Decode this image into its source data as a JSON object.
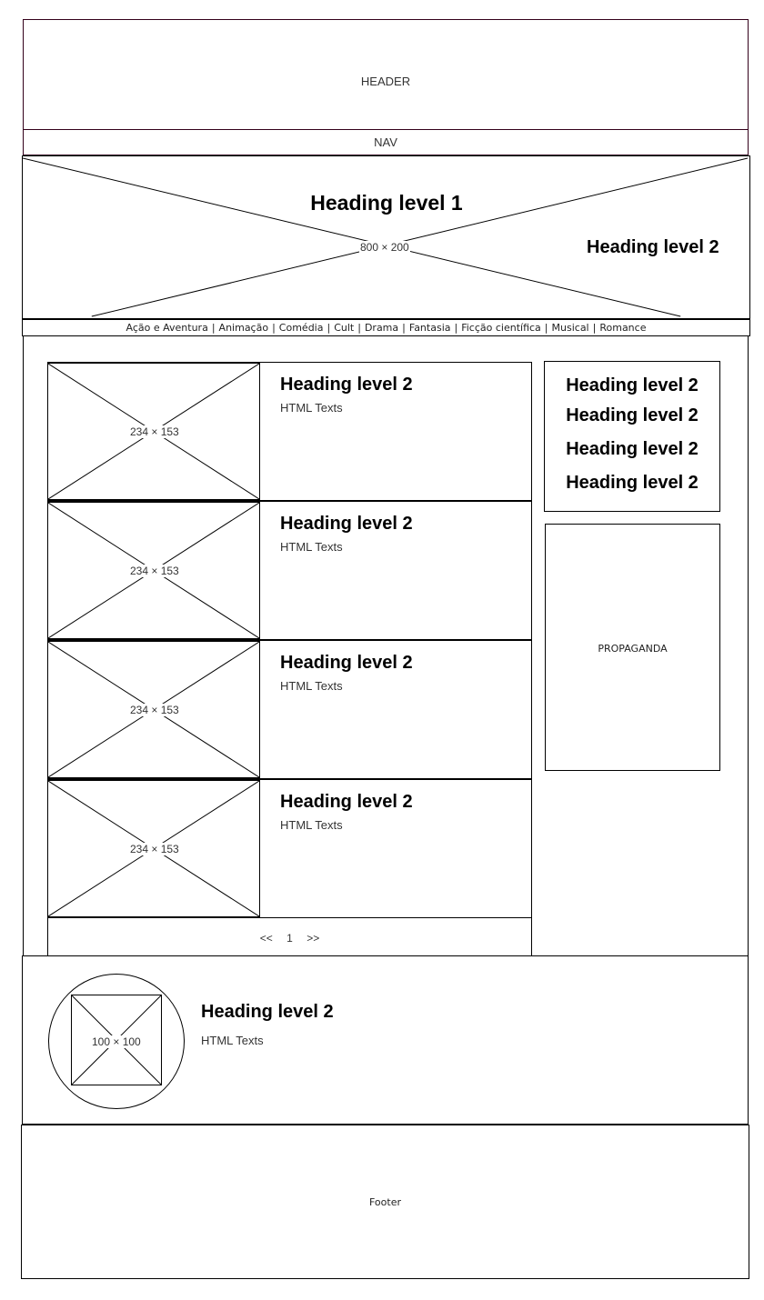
{
  "header": {
    "label": "HEADER"
  },
  "nav": {
    "label": "NAV"
  },
  "banner": {
    "placeholder": "800 × 200",
    "heading1": "Heading level 1",
    "heading2": "Heading level 2"
  },
  "genres": {
    "items": [
      "Ação e Aventura",
      "Animação",
      "Comédia",
      "Cult",
      "Drama",
      "Fantasia",
      "Ficção científica",
      "Musical",
      "Romance"
    ],
    "separator": "|"
  },
  "articles": [
    {
      "image": "234 × 153",
      "heading": "Heading level 2",
      "text": "HTML Texts"
    },
    {
      "image": "234 × 153",
      "heading": "Heading level 2",
      "text": "HTML Texts"
    },
    {
      "image": "234 × 153",
      "heading": "Heading level 2",
      "text": "HTML Texts"
    },
    {
      "image": "234 × 153",
      "heading": "Heading level 2",
      "text": "HTML Texts"
    }
  ],
  "pagination": {
    "prev": "<<",
    "current": "1",
    "next": ">>"
  },
  "sidebar": {
    "links": [
      "Heading level 2",
      "Heading level 2",
      "Heading level 2",
      "Heading level 2"
    ],
    "ad": "PROPAGANDA"
  },
  "profile": {
    "image": "100 × 100",
    "heading": "Heading level 2",
    "text": "HTML Texts"
  },
  "footer": {
    "label": "Footer"
  }
}
